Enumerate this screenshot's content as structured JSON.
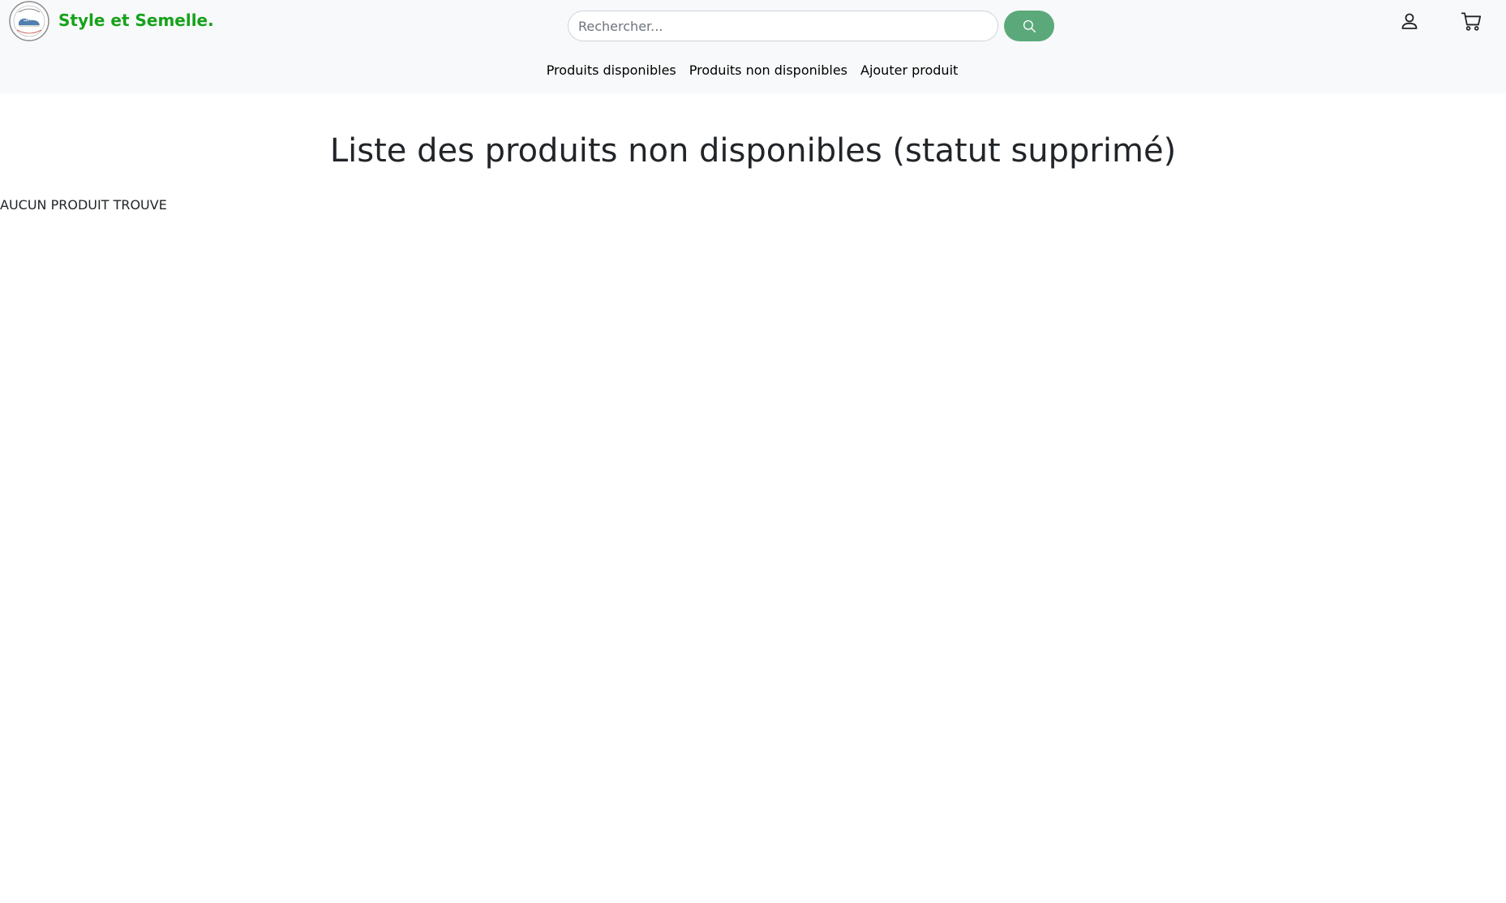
{
  "brand": {
    "name": "Style et Semelle.",
    "color": "#17a21b"
  },
  "search": {
    "placeholder": "Rechercher...",
    "value": "",
    "button_color": "#5ba97a"
  },
  "header_icons": {
    "user": "user-icon",
    "cart": "cart-icon"
  },
  "nav": {
    "links": [
      {
        "label": "Produits disponibles"
      },
      {
        "label": "Produits non disponibles"
      },
      {
        "label": "Ajouter produit"
      }
    ]
  },
  "main": {
    "title": "Liste des produits non disponibles (statut supprimé)",
    "empty_message": "AUCUN PRODUIT TROUVE"
  }
}
